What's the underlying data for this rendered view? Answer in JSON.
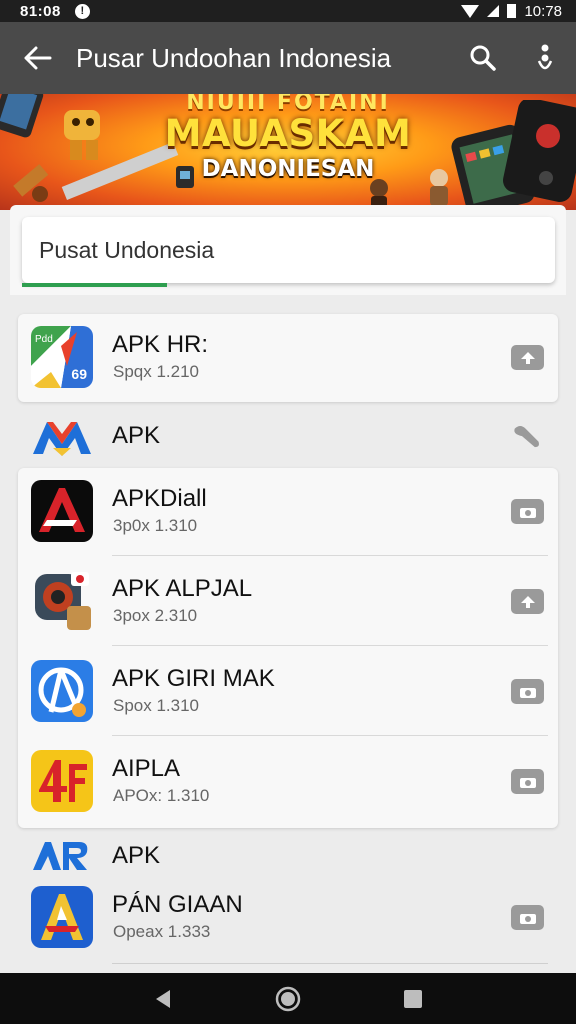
{
  "status_bar": {
    "time_left": "81:08",
    "time_right": "10:78",
    "info_badge": "!"
  },
  "app_bar": {
    "title": "Pusar Undoohan Indonesia",
    "icons": [
      "back-arrow-icon",
      "search-icon",
      "overflow-menu-icon"
    ]
  },
  "banner": {
    "line1": "NIUIII FOTAINI",
    "line2": "MAUASKAM",
    "line3": "DANONIESAN"
  },
  "search": {
    "value": "Pusat Undonesia"
  },
  "apps": [
    {
      "name": "APK HR:",
      "version": "Spqx 1.210",
      "icon": "colored-map-icon",
      "badge": "69",
      "action": "upload-icon"
    },
    {
      "name": "APK",
      "version": "",
      "icon": "m-logo-icon",
      "badge": "",
      "action": "pin-icon"
    },
    {
      "name": "APKDiall",
      "version": "3p0x 1.310",
      "icon": "red-a-icon",
      "badge": "",
      "action": "camera-icon"
    },
    {
      "name": "APK ALPJAL",
      "version": "3pox 2.310",
      "icon": "game-console-icon",
      "badge": "",
      "action": "upload-icon"
    },
    {
      "name": "APK GIRI MAK",
      "version": "Spox 1.310",
      "icon": "blue-app-icon",
      "badge": "",
      "action": "camera-icon"
    },
    {
      "name": "AIPLA",
      "version": "APOx: 1.310",
      "icon": "yellow-4f-icon",
      "badge": "",
      "action": "camera-icon"
    },
    {
      "name": "APK",
      "version": "",
      "icon": "ar-logo-icon",
      "badge": "",
      "action": ""
    },
    {
      "name": "PÁN GIAAN",
      "version": "Opeax 1.333",
      "icon": "blue-a-icon",
      "badge": "",
      "action": "camera-icon"
    }
  ],
  "colors": {
    "app_bar": "#4a4a4a",
    "status_bar": "#1f1f1f",
    "accent_progress": "#2e9e4f",
    "nav_bar": "#0d0d0d"
  }
}
